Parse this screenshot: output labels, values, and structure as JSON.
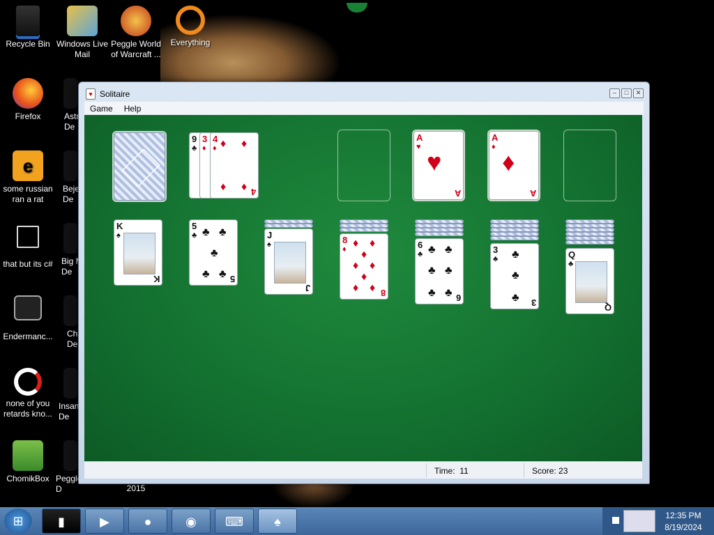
{
  "desktop": {
    "icons": [
      {
        "label": "Recycle Bin",
        "icon": "recycle-bin-icon"
      },
      {
        "label": "Windows Live Mail",
        "icon": "mail-icon"
      },
      {
        "label": "Peggle World of Warcraft ...",
        "icon": "peggle-icon"
      },
      {
        "label": "Everything",
        "icon": "search-icon"
      },
      {
        "label": "Firefox",
        "icon": "firefox-icon"
      },
      {
        "label": "Astr De",
        "icon": "app-icon"
      },
      {
        "label": "some russian ran a rat",
        "icon": "file-icon"
      },
      {
        "label": "Beje De",
        "icon": "app-icon"
      },
      {
        "label": "that but its c#",
        "icon": "shortcut-icon"
      },
      {
        "label": "Big M De",
        "icon": "app-icon"
      },
      {
        "label": "Endermanc...",
        "icon": "app-icon"
      },
      {
        "label": "Ch De",
        "icon": "app-icon"
      },
      {
        "label": "none of you retards kno...",
        "icon": "app-icon"
      },
      {
        "label": "Insan De",
        "icon": "app-icon"
      },
      {
        "label": "ChomikBox",
        "icon": "chomikbox-icon"
      },
      {
        "label": "Peggle D",
        "icon": "peggle-icon"
      },
      {
        "label": "2015",
        "icon": "visual-studio-icon"
      }
    ]
  },
  "window": {
    "title": "Solitaire",
    "menu": [
      "Game",
      "Help"
    ],
    "status": {
      "time_label": "Time:",
      "time_value": "11",
      "score_label": "Score:",
      "score_value": "23"
    }
  },
  "game": {
    "stock": {
      "state": "face-down"
    },
    "waste": [
      {
        "rank": "9",
        "suit": "♣",
        "color": "black"
      },
      {
        "rank": "3",
        "suit": "♦",
        "color": "red"
      },
      {
        "rank": "4",
        "suit": "♦",
        "color": "red"
      }
    ],
    "foundations": [
      {
        "rank": "",
        "suit": ""
      },
      {
        "rank": "A",
        "suit": "♥",
        "color": "red"
      },
      {
        "rank": "A",
        "suit": "♦",
        "color": "red"
      },
      {
        "rank": "",
        "suit": ""
      }
    ],
    "tableau": [
      {
        "hidden": 0,
        "top": {
          "rank": "K",
          "suit": "♠",
          "color": "black",
          "face": true
        }
      },
      {
        "hidden": 0,
        "top": {
          "rank": "5",
          "suit": "♣",
          "color": "black"
        }
      },
      {
        "hidden": 2,
        "top": {
          "rank": "J",
          "suit": "♠",
          "color": "black",
          "face": true
        }
      },
      {
        "hidden": 3,
        "top": {
          "rank": "8",
          "suit": "♦",
          "color": "red"
        }
      },
      {
        "hidden": 4,
        "top": {
          "rank": "6",
          "suit": "♣",
          "color": "black"
        }
      },
      {
        "hidden": 5,
        "top": {
          "rank": "3",
          "suit": "♣",
          "color": "black"
        }
      },
      {
        "hidden": 6,
        "top": {
          "rank": "Q",
          "suit": "♣",
          "color": "black",
          "face": true
        }
      }
    ]
  },
  "taskbar": {
    "items": [
      "terminal-icon",
      "media-player-icon",
      "globe-icon",
      "firefox-icon",
      "keyboard-icon",
      "solitaire-icon"
    ],
    "clock_time": "12:35 PM",
    "clock_date": "8/19/2024"
  }
}
